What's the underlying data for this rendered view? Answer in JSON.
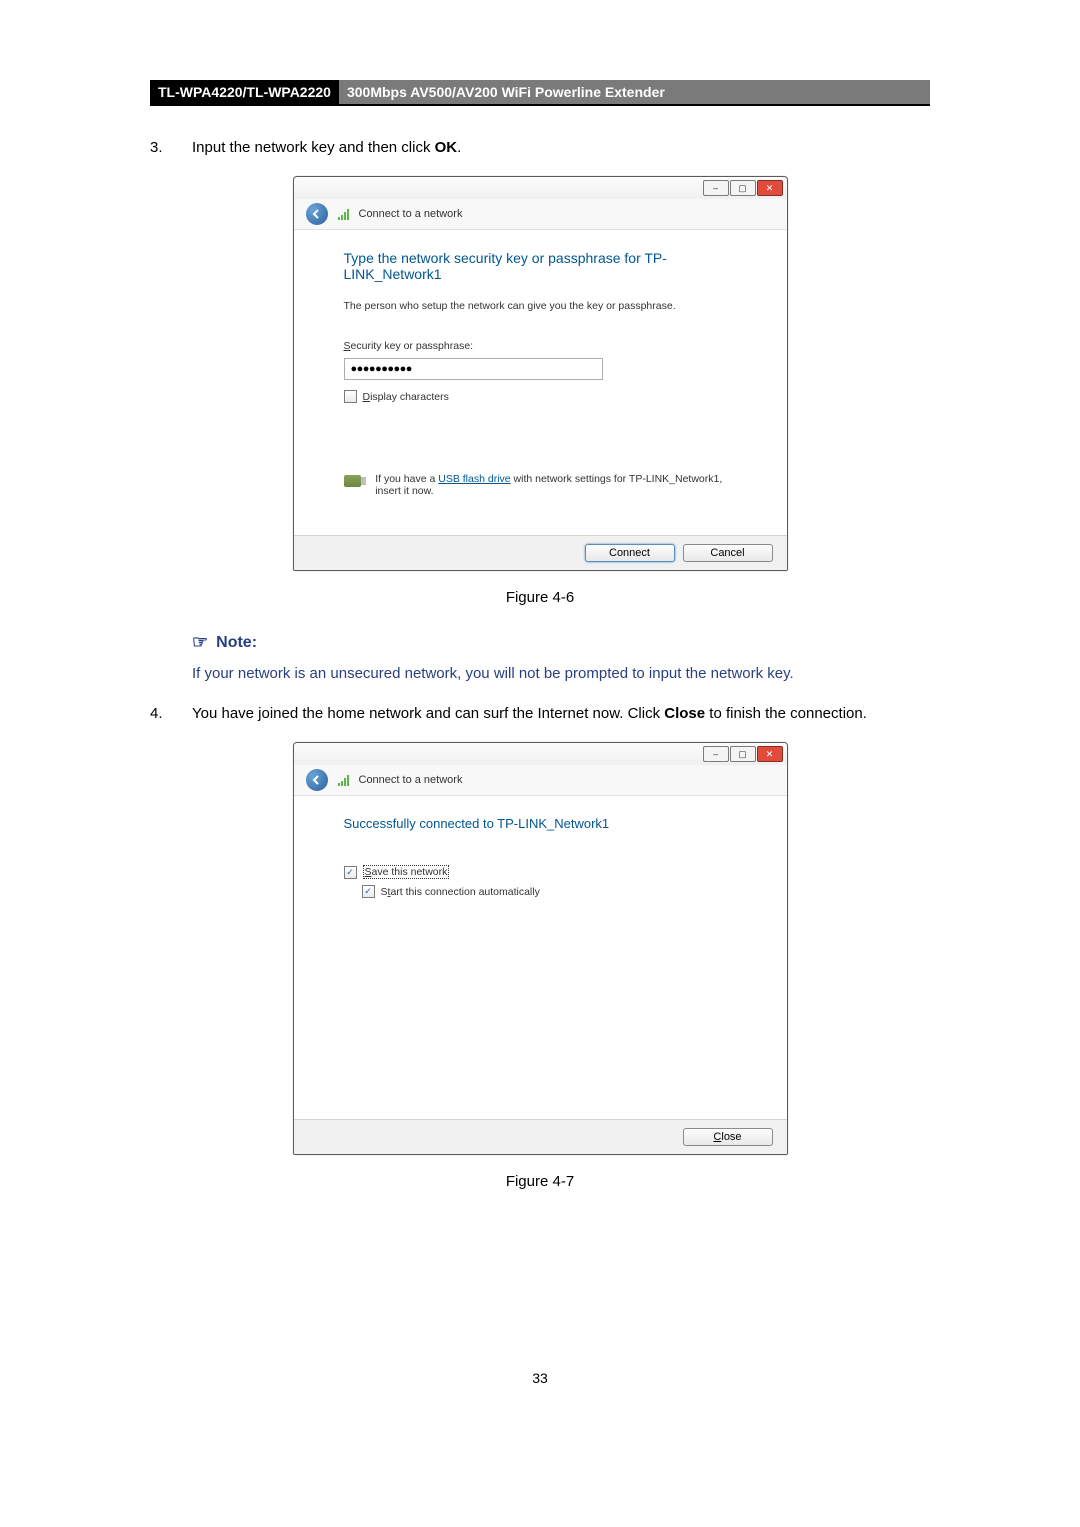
{
  "header": {
    "model": "TL-WPA4220/TL-WPA2220",
    "product": "300Mbps AV500/AV200 WiFi Powerline Extender"
  },
  "step3": {
    "num": "3.",
    "text_pre": "Input the network key and then click ",
    "text_bold": "OK",
    "text_post": "."
  },
  "dialog1": {
    "nav_title": "Connect to a network",
    "main_msg": "Type the network security key or passphrase for TP-LINK_Network1",
    "sub_msg": "The person who setup the network can give you the key or passphrase.",
    "sec_label": "Security key or passphrase:",
    "pw_value": "●●●●●●●●●●",
    "chk_display": "Display characters",
    "usb_pre": "If you have a ",
    "usb_link": "USB flash drive",
    "usb_post": " with network settings for TP-LINK_Network1, insert it now.",
    "btn_connect": "Connect",
    "btn_cancel": "Cancel"
  },
  "fig1_caption": "Figure 4-6",
  "note": {
    "label": "Note:",
    "text": "If your network is an unsecured network, you will not be prompted to input the network key."
  },
  "step4": {
    "num": "4.",
    "text_pre": "You have joined the home network and can surf the Internet now. Click ",
    "text_bold": "Close",
    "text_post": " to finish the connection."
  },
  "dialog2": {
    "nav_title": "Connect to a network",
    "success_msg": "Successfully connected to TP-LINK_Network1",
    "chk_save": "Save this network",
    "chk_start": "Start this connection automatically",
    "btn_close": "Close"
  },
  "fig2_caption": "Figure 4-7",
  "page_num": "33"
}
